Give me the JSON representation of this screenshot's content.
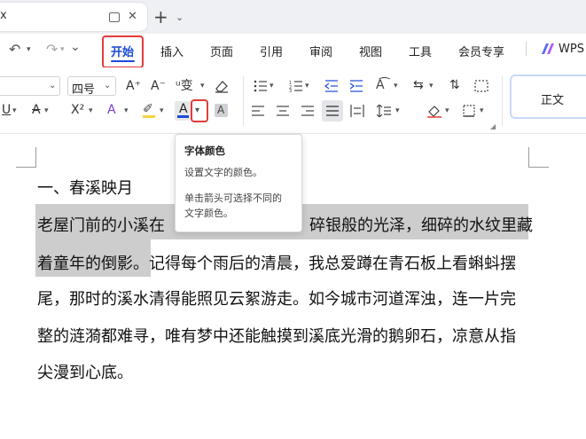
{
  "titlebar": {
    "doc_tab_title": "x",
    "new_tab_plus": "+",
    "close_glyph": "✕",
    "dropdown_glyph": "⌄"
  },
  "menu": {
    "undo_glyph": "↶",
    "redo_glyph": "↷",
    "more_glyph": "⌄",
    "items": [
      "开始",
      "插入",
      "页面",
      "引用",
      "审阅",
      "视图",
      "工具",
      "会员专享"
    ],
    "wps_label": "WPS"
  },
  "ribbon": {
    "font_size_value": "四号",
    "increase_font": "A⁺",
    "decrease_font": "A⁻",
    "phonetic_guide": "ᵘ变",
    "underline": "U",
    "strike": "A",
    "superscript": "X²",
    "text_effect": "A",
    "highlight": "✐",
    "font_color": "A",
    "char_shading": "A",
    "style_normal": "正文"
  },
  "document": {
    "heading": "一、春溪映月",
    "lines": [
      "老屋门前的小溪在",
      "着童年的倒影。记得每个雨后的清晨，我总爱蹲在青石板上看蝌蚪摆",
      "尾，那时的溪水清得能照见云絮游走。如今城市河道浑浊，连一片完",
      "整的涟漪都难寻，唯有梦中还能触摸到溪底光滑的鹅卵石，凉意从指",
      "尖漫到心底。"
    ],
    "line1_tail": "碎银般的光泽，细碎的水纹里藏",
    "line2_selected": "着童年的倒影。"
  },
  "tooltip": {
    "title": "字体颜色",
    "desc": "设置文字的颜色。",
    "hint_line1": "单击箭头可选择不同的",
    "hint_line2": "文字颜色。"
  },
  "colors": {
    "accent_blue": "#1c4ad6",
    "highlight_red": "#e23b3b",
    "selection_gray": "#cdcdcd"
  }
}
